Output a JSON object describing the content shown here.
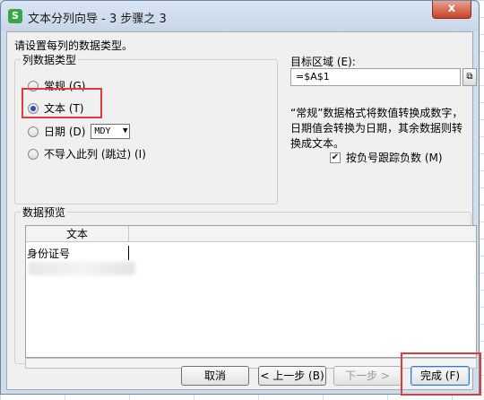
{
  "window": {
    "title": "文本分列向导 - 3 步骤之 3",
    "close": "x"
  },
  "prompt": "请设置每列的数据类型。",
  "column_type": {
    "group_title": "列数据类型",
    "options": [
      {
        "label": "常规 (G)",
        "selected": false
      },
      {
        "label": "文本 (T)",
        "selected": true
      },
      {
        "label": "日期 (D)",
        "selected": false
      },
      {
        "label": "不导入此列 (跳过) (I)",
        "selected": false
      }
    ],
    "date_format": "MDY"
  },
  "destination": {
    "label": "目标区域 (E):",
    "value": "=$A$1"
  },
  "description": "“常规”数据格式将数值转换成数字，日期值会转换为日期，其余数据则转换成文本。",
  "negative_option": {
    "label": "按负号跟踪负数 (M)",
    "checked": true
  },
  "preview": {
    "group_title": "数据预览",
    "column_header": "文本",
    "rows": [
      "身份证号",
      ""
    ]
  },
  "buttons": {
    "cancel": "取消",
    "back": "< 上一步 (B)",
    "next": "下一步 >",
    "finish": "完成 (F)"
  },
  "colors": {
    "highlight": "#e03a3a",
    "accent": "#2a4fb0"
  }
}
